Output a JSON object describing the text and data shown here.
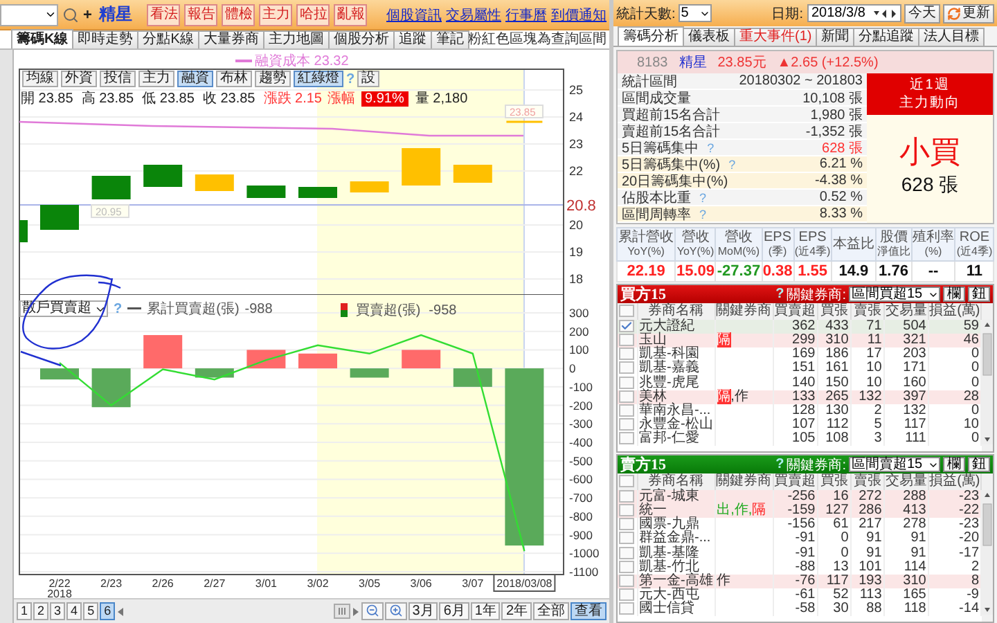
{
  "toolbar": {
    "add_symbol": "+",
    "stock_name": "精星",
    "action_buttons": [
      "看法",
      "報告",
      "體檢",
      "主力",
      "哈拉",
      "亂報"
    ],
    "links": [
      "個股資訊",
      "交易屬性",
      "行事曆",
      "到價通知"
    ]
  },
  "tabs": [
    {
      "label": "籌碼K線",
      "selected": true
    },
    {
      "label": "即時走勢",
      "selected": false
    },
    {
      "label": "分點K線",
      "selected": false
    },
    {
      "label": "大量券商",
      "selected": false
    },
    {
      "label": "主力地圖",
      "selected": false
    },
    {
      "label": "個股分析",
      "selected": false
    },
    {
      "label": "追蹤",
      "selected": false
    },
    {
      "label": "筆記",
      "selected": false
    }
  ],
  "note": "粉紅色區塊為查詢區間",
  "chart": {
    "legend": "融資成本 23.32",
    "indicator_buttons": [
      {
        "label": "均線",
        "selected": false
      },
      {
        "label": "外資",
        "selected": false
      },
      {
        "label": "投信",
        "selected": false
      },
      {
        "label": "主力",
        "selected": false
      },
      {
        "label": "融資",
        "selected": true
      },
      {
        "label": "布林",
        "selected": false
      },
      {
        "label": "趨勢",
        "selected": false
      },
      {
        "label": "紅綠燈",
        "selected": true
      }
    ],
    "help": "?",
    "settings": "設",
    "ohlc": [
      "開 23.85",
      "高 23.85",
      "低 23.85",
      "收 23.85"
    ],
    "change": "漲跌 2.15",
    "change_pct_label": "漲幅",
    "change_pct": "9.91%",
    "volume": "量 2,180",
    "price_axis": [
      "25",
      "24",
      "23",
      "22",
      "20",
      "19",
      "18"
    ],
    "price_marker": "20.8",
    "price_tags": [
      "20.95",
      "23.85"
    ],
    "indicator_select": "散戶買賣超",
    "cumulative_value": "-988",
    "bar_value": "-958",
    "year_label": "2018",
    "chart_data": {
      "type": "bar",
      "categories": [
        "2/22",
        "2/23",
        "2/26",
        "2/27",
        "3/01",
        "3/02",
        "3/05",
        "3/06",
        "3/07",
        "2018/03/08"
      ],
      "series": [
        {
          "name": "買賣超(張)",
          "type": "bar",
          "color": "#ff6a6a",
          "values": [
            null,
            null,
            180,
            null,
            100,
            80,
            null,
            100,
            null,
            null
          ]
        },
        {
          "type": "bar",
          "color": "#5aaa5a",
          "values": [
            -60,
            -210,
            null,
            -50,
            null,
            null,
            -50,
            null,
            -100,
            -958
          ]
        },
        {
          "name": "累計買賣超(張)",
          "type": "line",
          "color": "#33dd33",
          "values": [
            30,
            -200,
            -5,
            -60,
            45,
            125,
            80,
            180,
            80,
            -988
          ]
        }
      ],
      "grid": true,
      "ylim": [
        -1100,
        300
      ],
      "yticks": [
        300,
        200,
        100,
        0,
        -100,
        -200,
        -300,
        -400,
        -500,
        -600,
        -700,
        -800,
        -900,
        -1000,
        -1100
      ]
    }
  },
  "pager": {
    "pages": [
      {
        "label": "1",
        "selected": false
      },
      {
        "label": "2",
        "selected": false
      },
      {
        "label": "3",
        "selected": false
      },
      {
        "label": "4",
        "selected": false
      },
      {
        "label": "5",
        "selected": false
      },
      {
        "label": "6",
        "selected": true
      }
    ],
    "ranges": [
      {
        "label": "3月",
        "selected": false
      },
      {
        "label": "6月",
        "selected": false
      },
      {
        "label": "1年",
        "selected": false
      },
      {
        "label": "2年",
        "selected": false
      },
      {
        "label": "全部",
        "selected": false
      },
      {
        "label": "查看",
        "selected": true
      }
    ]
  },
  "filters": {
    "days_label": "統計天數:",
    "days": "5",
    "date_label": "日期:",
    "date": "2018/3/8",
    "today": "今天",
    "refresh": "更新"
  },
  "right_tabs": [
    {
      "label": "籌碼分析",
      "selected": true,
      "alert": false
    },
    {
      "label": "儀表板",
      "selected": false,
      "alert": false
    },
    {
      "label": "重大事件(1)",
      "selected": false,
      "alert": true
    },
    {
      "label": "新聞",
      "selected": false,
      "alert": false
    },
    {
      "label": "分點追蹤",
      "selected": false,
      "alert": false
    },
    {
      "label": "法人目標",
      "selected": false,
      "alert": false
    }
  ],
  "summary": {
    "help_text": "?",
    "code": "8183",
    "name": "精星",
    "price": "23.85元",
    "change": "▲2.65 (+12.5%)",
    "rows": [
      {
        "label": "統計區間",
        "help": false,
        "value": "20180302 ~ 201803",
        "color": "#333333",
        "highlighted": false
      },
      {
        "label": "區間成交量",
        "help": false,
        "value": "10,108 張",
        "color": "#333333",
        "highlighted": false
      },
      {
        "label": "買超前15名合計",
        "help": false,
        "value": "1,980 張",
        "color": "#333333",
        "highlighted": false
      },
      {
        "label": "賣超前15名合計",
        "help": false,
        "value": "-1,352 張",
        "color": "#333333",
        "highlighted": false
      },
      {
        "label": "5日籌碼集中",
        "help": true,
        "value": "628 張",
        "color": "#ff3333",
        "highlighted": false
      },
      {
        "label": "5日籌碼集中(%)",
        "help": true,
        "value": "6.21 %",
        "color": "#333333",
        "highlighted": true
      },
      {
        "label": "20日籌碼集中(%)",
        "help": false,
        "value": "-4.38 %",
        "color": "#333333",
        "highlighted": true
      },
      {
        "label": "佔股本比重",
        "help": true,
        "value": "0.52 %",
        "color": "#333333",
        "highlighted": false
      },
      {
        "label": "區間周轉率",
        "help": true,
        "value": "8.33 %",
        "color": "#333333",
        "highlighted": true
      }
    ],
    "trend": {
      "period": "近1週",
      "title": "主力動向",
      "verdict": "小買",
      "amount": "628 張"
    }
  },
  "fundamentals": [
    {
      "label": [
        "累計營收",
        "YoY(%)"
      ],
      "value": "22.19",
      "color": "#ff2222"
    },
    {
      "label": [
        "營收",
        "YoY(%)"
      ],
      "value": "15.09",
      "color": "#ff2222"
    },
    {
      "label": [
        "營收",
        "MoM(%)"
      ],
      "value": "-27.37",
      "color": "#229922"
    },
    {
      "label": [
        "EPS",
        "(季)"
      ],
      "value": "0.38",
      "color": "#ff2222"
    },
    {
      "label": [
        "EPS",
        "(近4季)"
      ],
      "value": "1.55",
      "color": "#ff2222"
    },
    {
      "label": [
        "本益比"
      ],
      "value": "14.9",
      "color": "#111111"
    },
    {
      "label": [
        "股價",
        "淨值比"
      ],
      "value": "1.76",
      "color": "#111111"
    },
    {
      "label": [
        "殖利率",
        "(%)"
      ],
      "value": "--",
      "color": "#111111"
    },
    {
      "label": [
        "ROE",
        "(近4季)"
      ],
      "value": "11",
      "color": "#111111"
    }
  ],
  "buy_side": {
    "title": "買方15",
    "all_checked": false,
    "help": "?",
    "filter_label": "關鍵券商:",
    "filter": "區間買超15",
    "buttons": [
      "欄",
      "鈕"
    ],
    "columns": [
      "券商名稱",
      "關鍵券商",
      "買賣超",
      "買張",
      "賣張",
      "交易量",
      "損益(萬)"
    ],
    "rows": [
      {
        "checked": true,
        "highlighted": false,
        "name": "元大證紀",
        "tags": [],
        "values": [
          "362",
          "433",
          "71",
          "504",
          "59"
        ]
      },
      {
        "checked": false,
        "highlighted": true,
        "name": "玉山",
        "tags": [
          {
            "text": "隔",
            "color": "#ff3333",
            "boxed": true
          }
        ],
        "values": [
          "299",
          "310",
          "11",
          "321",
          "46"
        ]
      },
      {
        "checked": false,
        "highlighted": false,
        "name": "凱基-科園",
        "tags": [],
        "values": [
          "169",
          "186",
          "17",
          "203",
          "0"
        ]
      },
      {
        "checked": false,
        "highlighted": false,
        "name": "凱基-嘉義",
        "tags": [],
        "values": [
          "151",
          "161",
          "10",
          "171",
          "0"
        ]
      },
      {
        "checked": false,
        "highlighted": false,
        "name": "兆豐-虎尾",
        "tags": [],
        "values": [
          "140",
          "150",
          "10",
          "160",
          "0"
        ]
      },
      {
        "checked": false,
        "highlighted": true,
        "name": "美林",
        "tags": [
          {
            "text": "隔",
            "color": "#ff3333",
            "boxed": true
          },
          {
            "text": ",作",
            "color": "#333333",
            "boxed": false
          }
        ],
        "values": [
          "133",
          "265",
          "132",
          "397",
          "28"
        ]
      },
      {
        "checked": false,
        "highlighted": false,
        "name": "華南永昌-...",
        "tags": [],
        "values": [
          "128",
          "130",
          "2",
          "132",
          "0"
        ]
      },
      {
        "checked": false,
        "highlighted": false,
        "name": "永豐金-松山",
        "tags": [],
        "values": [
          "107",
          "112",
          "5",
          "117",
          "10"
        ]
      },
      {
        "checked": false,
        "highlighted": false,
        "name": "富邦-仁愛",
        "tags": [],
        "values": [
          "105",
          "108",
          "3",
          "111",
          "0"
        ]
      }
    ]
  },
  "sell_side": {
    "title": "賣方15",
    "all_checked": false,
    "help": "?",
    "filter_label": "關鍵券商:",
    "filter": "區間賣超15",
    "buttons": [
      "欄",
      "鈕"
    ],
    "columns": [
      "券商名稱",
      "關鍵券商",
      "買賣超",
      "買張",
      "賣張",
      "交易量",
      "損益(萬)"
    ],
    "rows": [
      {
        "checked": false,
        "highlighted": true,
        "name": "元富-城東",
        "tags": [],
        "values": [
          "-256",
          "16",
          "272",
          "288",
          "-23"
        ]
      },
      {
        "checked": false,
        "highlighted": true,
        "name": "統一",
        "tags": [
          {
            "text": "出,作,",
            "color": "#22aa22",
            "boxed": false
          },
          {
            "text": "隔",
            "color": "#ff2222",
            "boxed": false
          }
        ],
        "values": [
          "-159",
          "127",
          "286",
          "413",
          "-22"
        ]
      },
      {
        "checked": false,
        "highlighted": false,
        "name": "國票-九鼎",
        "tags": [],
        "values": [
          "-156",
          "61",
          "217",
          "278",
          "-23"
        ]
      },
      {
        "checked": false,
        "highlighted": false,
        "name": "群益金鼎-...",
        "tags": [],
        "values": [
          "-91",
          "0",
          "91",
          "91",
          "-20"
        ]
      },
      {
        "checked": false,
        "highlighted": false,
        "name": "凱基-基隆",
        "tags": [],
        "values": [
          "-91",
          "0",
          "91",
          "91",
          "-17"
        ]
      },
      {
        "checked": false,
        "highlighted": false,
        "name": "凱基-竹北",
        "tags": [],
        "values": [
          "-88",
          "13",
          "101",
          "114",
          "2"
        ]
      },
      {
        "checked": false,
        "highlighted": true,
        "name": "第一金-高雄",
        "tags": [
          {
            "text": "作",
            "color": "#333333",
            "boxed": false
          }
        ],
        "values": [
          "-76",
          "117",
          "193",
          "310",
          "8"
        ]
      },
      {
        "checked": false,
        "highlighted": false,
        "name": "元大-西屯",
        "tags": [],
        "values": [
          "-61",
          "52",
          "113",
          "165",
          "-9"
        ]
      },
      {
        "checked": false,
        "highlighted": false,
        "name": "國士信貸",
        "tags": [],
        "values": [
          "-58",
          "30",
          "88",
          "118",
          "-14"
        ]
      }
    ]
  }
}
